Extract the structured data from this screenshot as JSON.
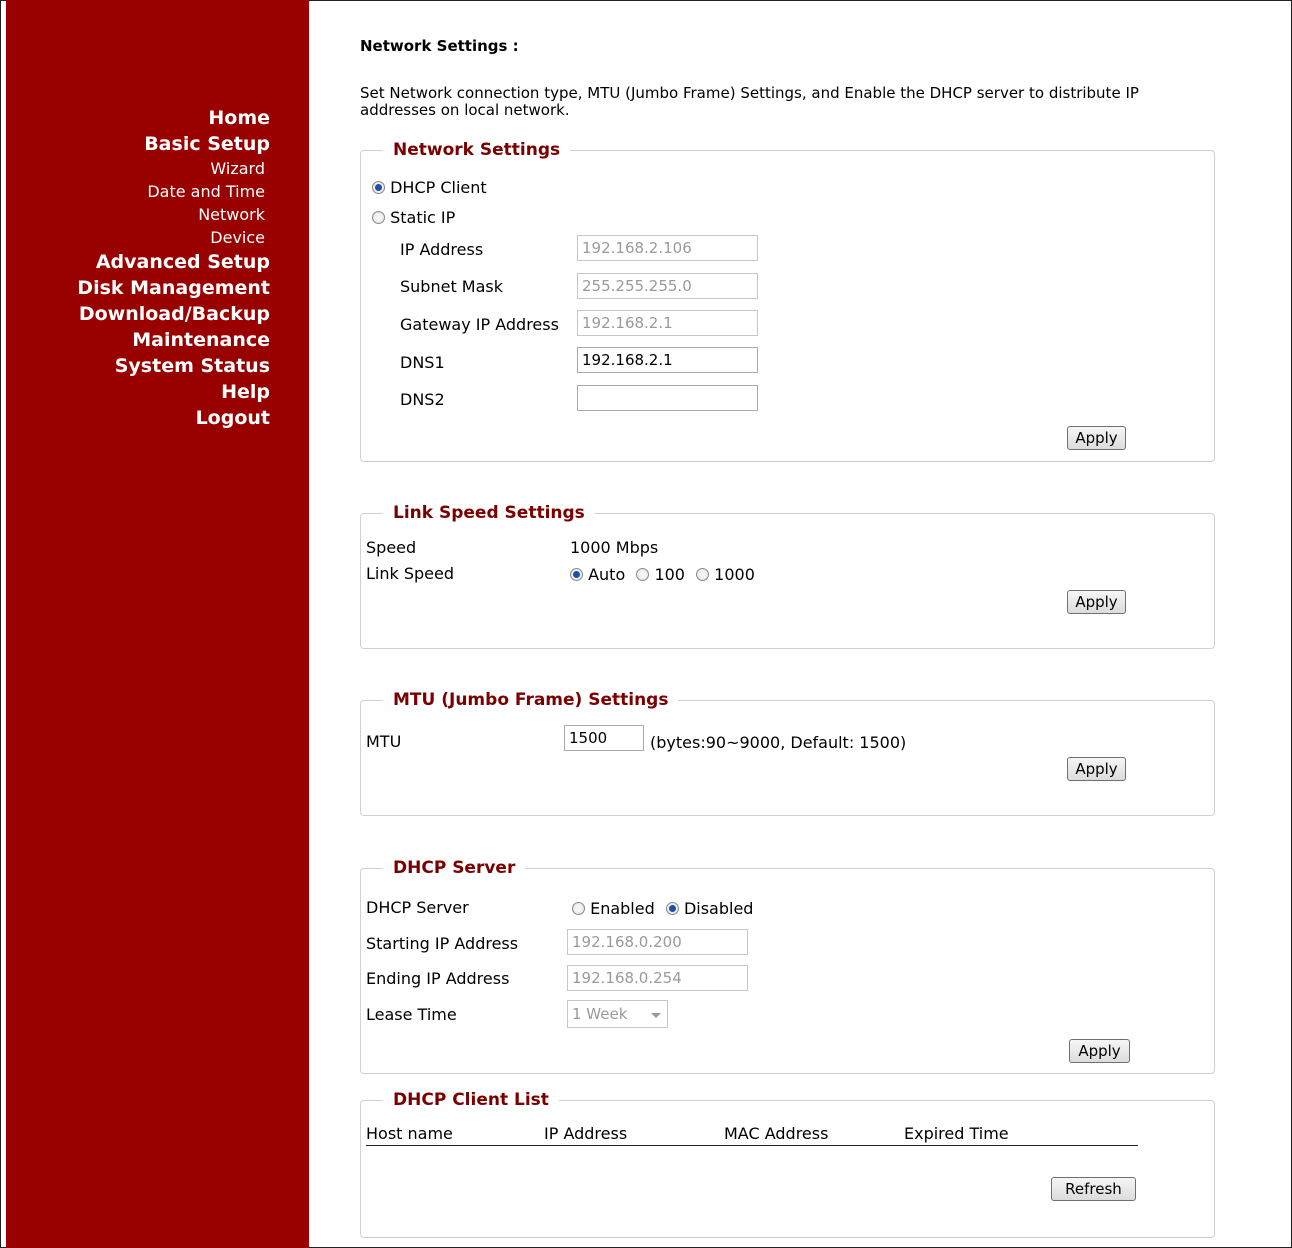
{
  "nav": {
    "items": [
      {
        "label": "Home",
        "level": "main"
      },
      {
        "label": "Basic Setup",
        "level": "main"
      },
      {
        "label": "Wizard",
        "level": "sub"
      },
      {
        "label": "Date and Time",
        "level": "sub"
      },
      {
        "label": "Network",
        "level": "sub"
      },
      {
        "label": "Device",
        "level": "sub"
      },
      {
        "label": "Advanced Setup",
        "level": "main"
      },
      {
        "label": "Disk Management",
        "level": "main"
      },
      {
        "label": "Download/Backup",
        "level": "main"
      },
      {
        "label": "Maintenance",
        "level": "main"
      },
      {
        "label": "System Status",
        "level": "main"
      },
      {
        "label": "Help",
        "level": "main"
      },
      {
        "label": "Logout",
        "level": "main"
      }
    ]
  },
  "page": {
    "title": "Network Settings :",
    "description": "Set Network connection type, MTU (Jumbo Frame) Settings, and Enable the DHCP server to distribute IP addresses on local network."
  },
  "network": {
    "legend": "Network Settings",
    "dhcp_client": "DHCP Client",
    "static_ip": "Static IP",
    "ip_label": "IP Address",
    "ip_value": "192.168.2.106",
    "mask_label": "Subnet Mask",
    "mask_value": "255.255.255.0",
    "gateway_label": "Gateway IP Address",
    "gateway_value": "192.168.2.1",
    "dns1_label": "DNS1",
    "dns1_value": "192.168.2.1",
    "dns2_label": "DNS2",
    "dns2_value": "",
    "apply": "Apply"
  },
  "link": {
    "legend": "Link Speed Settings",
    "speed_label": "Speed",
    "speed_value": "1000 Mbps",
    "linkspeed_label": "Link Speed",
    "opt_auto": "Auto",
    "opt_100": "100",
    "opt_1000": "1000",
    "apply": "Apply"
  },
  "mtu": {
    "legend": "MTU (Jumbo Frame) Settings",
    "label": "MTU",
    "value": "1500",
    "hint": "(bytes:90~9000, Default: 1500)",
    "apply": "Apply"
  },
  "dhcp_server": {
    "legend": "DHCP Server",
    "server_label": "DHCP Server",
    "enabled": "Enabled",
    "disabled": "Disabled",
    "start_label": "Starting IP Address",
    "start_value": "192.168.0.200",
    "end_label": "Ending IP Address",
    "end_value": "192.168.0.254",
    "lease_label": "Lease Time",
    "lease_value": "1 Week",
    "apply": "Apply"
  },
  "client_list": {
    "legend": "DHCP Client List",
    "columns": [
      "Host name",
      "IP Address",
      "MAC Address",
      "Expired Time"
    ],
    "refresh": "Refresh"
  }
}
